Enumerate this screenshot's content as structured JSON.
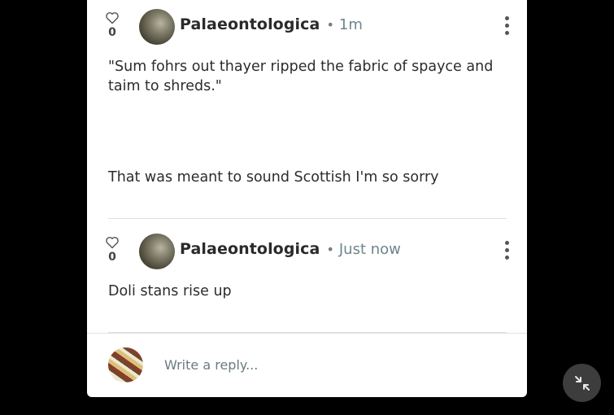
{
  "comments": [
    {
      "likes": "0",
      "author": "Palaeontologica",
      "separator": "•",
      "time": "1m",
      "paragraphs": [
        "\"Sum fohrs out thayer ripped the fabric of spayce and taim to shreds.\"",
        "That was meant to sound Scottish I'm so sorry"
      ]
    },
    {
      "likes": "0",
      "author": "Palaeontologica",
      "separator": "•",
      "time": "Just now",
      "paragraphs": [
        "Doli stans rise up"
      ]
    }
  ],
  "reply": {
    "placeholder": "Write a reply..."
  },
  "icons": {
    "like": "heart-outline-icon",
    "more": "vertical-ellipsis-icon",
    "minimize": "collapse-arrows-icon"
  },
  "colors": {
    "background": "#000000",
    "panel": "#ffffff",
    "time_text": "#6e858c",
    "fab": "#3d3d3d"
  }
}
